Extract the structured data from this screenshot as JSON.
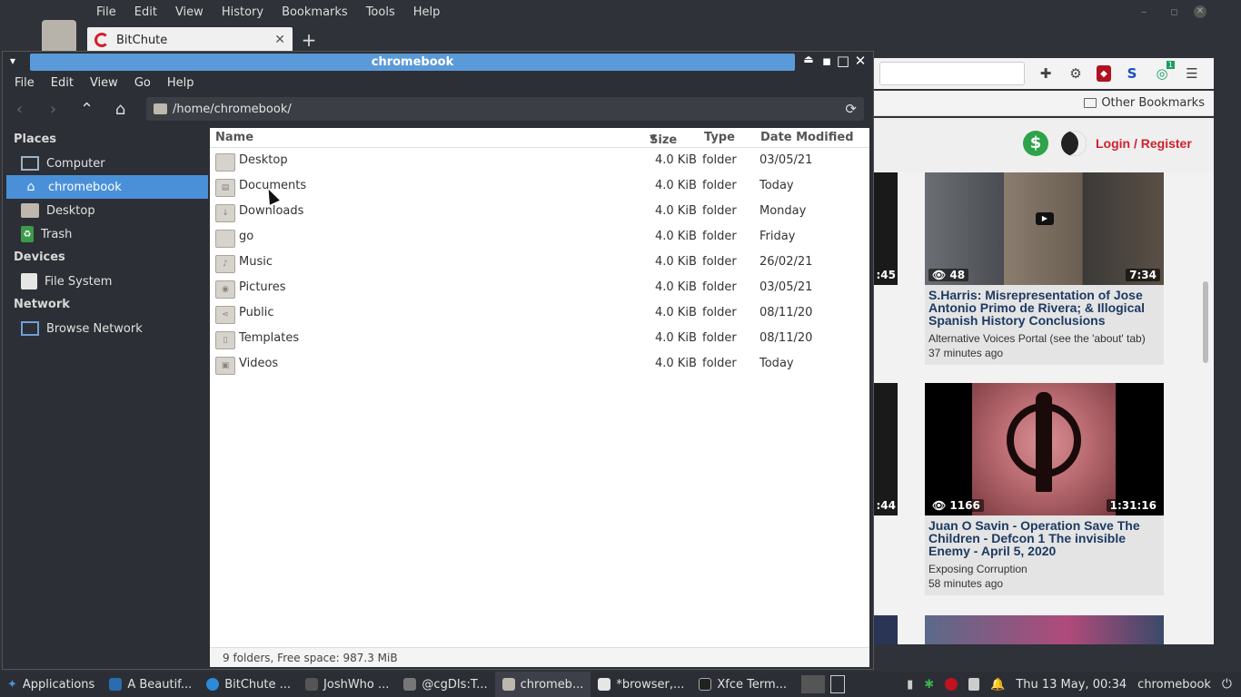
{
  "browser": {
    "menu": [
      "File",
      "Edit",
      "View",
      "History",
      "Bookmarks",
      "Tools",
      "Help"
    ],
    "tab_title": "BitChute",
    "tab_close": "✕",
    "new_tab": "+",
    "bookmarks_label": "Other Bookmarks",
    "ext_badge": "1",
    "login_label": "Login / Register",
    "videos": [
      {
        "views": "48",
        "duration": "7:34",
        "title": "S.Harris: Misrepresentation of Jose Antonio Primo de Rivera; & Illogical Spanish History Conclusions",
        "channel": "Alternative Voices Portal (see the 'about' tab)",
        "time": "37 minutes ago",
        "side_duration": ":45"
      },
      {
        "views": "1166",
        "duration": "1:31:16",
        "title": "Juan O Savin - Operation Save The Children - Defcon 1 The invisible Enemy - April 5, 2020",
        "channel": "Exposing Corruption",
        "time": "58 minutes ago",
        "side_duration": ":44"
      }
    ]
  },
  "file_manager": {
    "window_title": "chromebook",
    "menu": [
      "File",
      "Edit",
      "View",
      "Go",
      "Help"
    ],
    "path": "/home/chromebook/",
    "places_heading": "Places",
    "places": [
      {
        "label": "Computer",
        "icon": "computer-icon",
        "selected": false
      },
      {
        "label": "chromebook",
        "icon": "home-icon",
        "selected": true
      },
      {
        "label": "Desktop",
        "icon": "folder-icon",
        "selected": false
      },
      {
        "label": "Trash",
        "icon": "trash-icon",
        "selected": false
      }
    ],
    "devices_heading": "Devices",
    "devices": [
      {
        "label": "File System",
        "icon": "disk-icon"
      }
    ],
    "network_heading": "Network",
    "network": [
      {
        "label": "Browse Network",
        "icon": "network-icon"
      }
    ],
    "columns": {
      "name": "Name",
      "size": "Size",
      "type": "Type",
      "date": "Date Modified"
    },
    "files": [
      {
        "name": "Desktop",
        "size": "4.0 KiB",
        "type": "folder",
        "date": "03/05/21"
      },
      {
        "name": "Documents",
        "size": "4.0 KiB",
        "type": "folder",
        "date": "Today"
      },
      {
        "name": "Downloads",
        "size": "4.0 KiB",
        "type": "folder",
        "date": "Monday"
      },
      {
        "name": "go",
        "size": "4.0 KiB",
        "type": "folder",
        "date": "Friday"
      },
      {
        "name": "Music",
        "size": "4.0 KiB",
        "type": "folder",
        "date": "26/02/21"
      },
      {
        "name": "Pictures",
        "size": "4.0 KiB",
        "type": "folder",
        "date": "03/05/21"
      },
      {
        "name": "Public",
        "size": "4.0 KiB",
        "type": "folder",
        "date": "08/11/20"
      },
      {
        "name": "Templates",
        "size": "4.0 KiB",
        "type": "folder",
        "date": "08/11/20"
      },
      {
        "name": "Videos",
        "size": "4.0 KiB",
        "type": "folder",
        "date": "Today"
      }
    ],
    "status": "9 folders, Free space: 987.3 MiB"
  },
  "taskbar": {
    "applications": "Applications",
    "items": [
      {
        "label": "A Beautif...",
        "active": false
      },
      {
        "label": "BitChute ...",
        "active": false
      },
      {
        "label": "JoshWho ...",
        "active": false
      },
      {
        "label": "@cgDIs:T...",
        "active": false
      },
      {
        "label": "chromeb...",
        "active": true
      },
      {
        "label": "*browser,...",
        "active": false
      },
      {
        "label": "Xfce Term...",
        "active": false
      }
    ],
    "clock": "Thu 13 May, 00:34",
    "user": "chromebook"
  }
}
